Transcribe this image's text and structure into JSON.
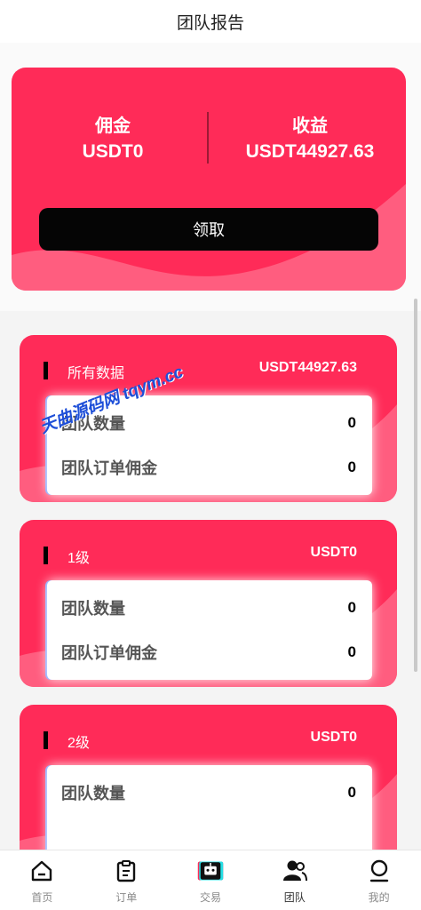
{
  "header": {
    "title": "团队报告"
  },
  "summary": {
    "commission_label": "佣金",
    "commission_value": "USDT0",
    "income_label": "收益",
    "income_value": "USDT44927.63",
    "claim_button": "领取"
  },
  "cards": [
    {
      "label": "所有数据",
      "value": "USDT44927.63",
      "rows": [
        {
          "label": "团队数量",
          "value": "0"
        },
        {
          "label": "团队订单佣金",
          "value": "0"
        }
      ]
    },
    {
      "label": "1级",
      "value": "USDT0",
      "rows": [
        {
          "label": "团队数量",
          "value": "0"
        },
        {
          "label": "团队订单佣金",
          "value": "0"
        }
      ]
    },
    {
      "label": "2级",
      "value": "USDT0",
      "rows": [
        {
          "label": "团队数量",
          "value": "0"
        }
      ]
    }
  ],
  "watermark": "天曲源码网 tqym.cc",
  "tabs": [
    {
      "label": "首页",
      "icon": "home-icon"
    },
    {
      "label": "订单",
      "icon": "clipboard-icon"
    },
    {
      "label": "交易",
      "icon": "robot-icon"
    },
    {
      "label": "团队",
      "icon": "team-icon",
      "active": true
    },
    {
      "label": "我的",
      "icon": "profile-icon"
    }
  ],
  "colors": {
    "card_red": "#ff2b58",
    "wave_pink": "#ff6f8c",
    "button_black": "#050505"
  }
}
